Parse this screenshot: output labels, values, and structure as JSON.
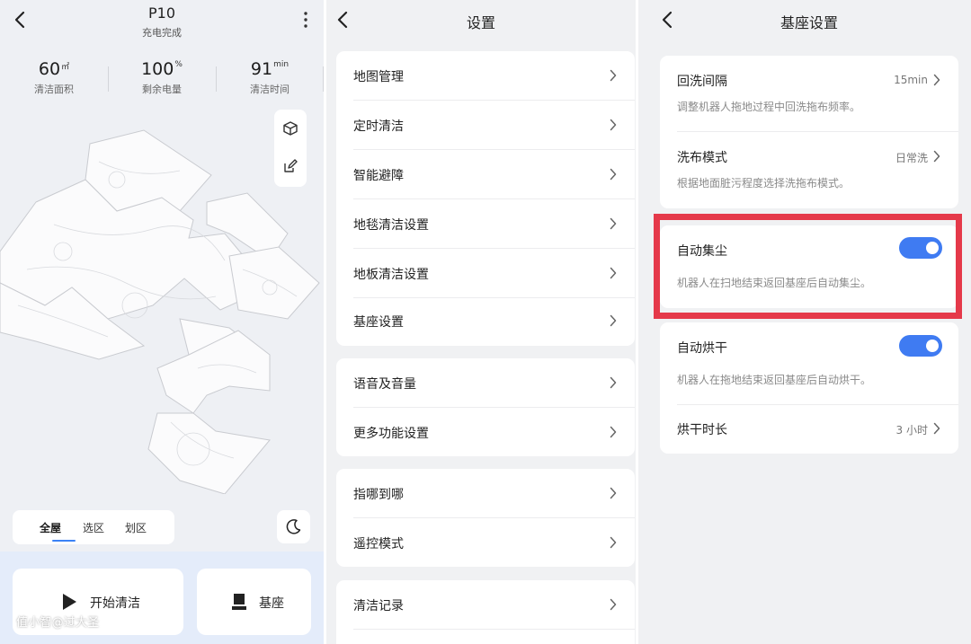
{
  "device": {
    "name": "P10",
    "status": "充电完成",
    "stats": [
      {
        "value": "60",
        "unit": "㎡",
        "label": "清洁面积"
      },
      {
        "value": "100",
        "unit": "%",
        "label": "剩余电量"
      },
      {
        "value": "91",
        "unit": "min",
        "label": "清洁时间"
      }
    ],
    "map_tools": [
      "cube-3d-icon",
      "edit-map-icon"
    ],
    "mode_tabs": [
      {
        "label": "全屋",
        "active": true
      },
      {
        "label": "选区",
        "active": false
      },
      {
        "label": "划区",
        "active": false
      }
    ],
    "start_clean_label": "开始清洁",
    "dock_label": "基座",
    "watermark": "值小智@过大圣"
  },
  "settings": {
    "title": "设置",
    "groups": [
      [
        "地图管理",
        "定时清洁",
        "智能避障",
        "地毯清洁设置",
        "地板清洁设置",
        "基座设置"
      ],
      [
        "语音及音量",
        "更多功能设置"
      ],
      [
        "指哪到哪",
        "遥控模式"
      ],
      [
        "清洁记录"
      ]
    ]
  },
  "dock_settings": {
    "title": "基座设置",
    "rinse_interval": {
      "title": "回洗间隔",
      "value": "15min",
      "desc": "调整机器人拖地过程中回洗拖布频率。"
    },
    "wash_mode": {
      "title": "洗布模式",
      "value": "日常洗",
      "desc": "根据地面脏污程度选择洗拖布模式。"
    },
    "auto_empty": {
      "title": "自动集尘",
      "enabled": true,
      "desc": "机器人在扫地结束返回基座后自动集尘。"
    },
    "auto_dry": {
      "title": "自动烘干",
      "enabled": true,
      "desc": "机器人在拖地结束返回基座后自动烘干。"
    },
    "dry_duration": {
      "title": "烘干时长",
      "value": "3 小时"
    }
  },
  "colors": {
    "accent": "#3f7bf2",
    "highlight": "#e5394a"
  }
}
